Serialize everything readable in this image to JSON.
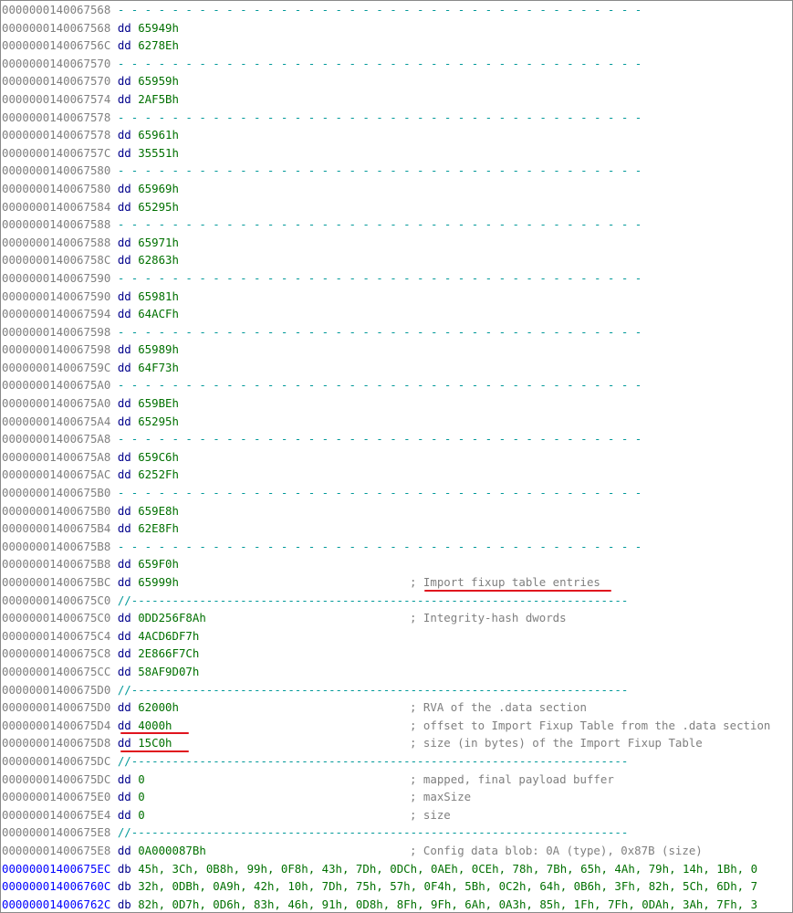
{
  "colors": {
    "address": "#7f7f7f",
    "address_blue": "#0000ff",
    "mnemonic": "#00008b",
    "operand": "#007000",
    "separator": "#009999",
    "comment": "#7f7f7f",
    "highlight_red": "#e0141e"
  },
  "lines": [
    {
      "addr": "0000000140067568",
      "sep": " - - - - - - - - - - - - - - - - - - - - - - - - - - - - - - - - - - - - - - -"
    },
    {
      "addr": "0000000140067568",
      "mn": "dd",
      "op": "65949h"
    },
    {
      "addr": "000000014006756C",
      "mn": "dd",
      "op": "6278Eh"
    },
    {
      "addr": "0000000140067570",
      "sep": " - - - - - - - - - - - - - - - - - - - - - - - - - - - - - - - - - - - - - - -"
    },
    {
      "addr": "0000000140067570",
      "mn": "dd",
      "op": "65959h"
    },
    {
      "addr": "0000000140067574",
      "mn": "dd",
      "op": "2AF5Bh"
    },
    {
      "addr": "0000000140067578",
      "sep": " - - - - - - - - - - - - - - - - - - - - - - - - - - - - - - - - - - - - - - -"
    },
    {
      "addr": "0000000140067578",
      "mn": "dd",
      "op": "65961h"
    },
    {
      "addr": "000000014006757C",
      "mn": "dd",
      "op": "35551h"
    },
    {
      "addr": "0000000140067580",
      "sep": " - - - - - - - - - - - - - - - - - - - - - - - - - - - - - - - - - - - - - - -"
    },
    {
      "addr": "0000000140067580",
      "mn": "dd",
      "op": "65969h"
    },
    {
      "addr": "0000000140067584",
      "mn": "dd",
      "op": "65295h"
    },
    {
      "addr": "0000000140067588",
      "sep": " - - - - - - - - - - - - - - - - - - - - - - - - - - - - - - - - - - - - - - -"
    },
    {
      "addr": "0000000140067588",
      "mn": "dd",
      "op": "65971h"
    },
    {
      "addr": "000000014006758C",
      "mn": "dd",
      "op": "62863h"
    },
    {
      "addr": "0000000140067590",
      "sep": " - - - - - - - - - - - - - - - - - - - - - - - - - - - - - - - - - - - - - - -"
    },
    {
      "addr": "0000000140067590",
      "mn": "dd",
      "op": "65981h"
    },
    {
      "addr": "0000000140067594",
      "mn": "dd",
      "op": "64ACFh"
    },
    {
      "addr": "0000000140067598",
      "sep": " - - - - - - - - - - - - - - - - - - - - - - - - - - - - - - - - - - - - - - -"
    },
    {
      "addr": "0000000140067598",
      "mn": "dd",
      "op": "65989h"
    },
    {
      "addr": "000000014006759C",
      "mn": "dd",
      "op": "64F73h"
    },
    {
      "addr": "00000001400675A0",
      "sep": " - - - - - - - - - - - - - - - - - - - - - - - - - - - - - - - - - - - - - - -"
    },
    {
      "addr": "00000001400675A0",
      "mn": "dd",
      "op": "659BEh"
    },
    {
      "addr": "00000001400675A4",
      "mn": "dd",
      "op": "65295h"
    },
    {
      "addr": "00000001400675A8",
      "sep": " - - - - - - - - - - - - - - - - - - - - - - - - - - - - - - - - - - - - - - -"
    },
    {
      "addr": "00000001400675A8",
      "mn": "dd",
      "op": "659C6h"
    },
    {
      "addr": "00000001400675AC",
      "mn": "dd",
      "op": "6252Fh"
    },
    {
      "addr": "00000001400675B0",
      "sep": " - - - - - - - - - - - - - - - - - - - - - - - - - - - - - - - - - - - - - - -"
    },
    {
      "addr": "00000001400675B0",
      "mn": "dd",
      "op": "659E8h"
    },
    {
      "addr": "00000001400675B4",
      "mn": "dd",
      "op": "62E8Fh"
    },
    {
      "addr": "00000001400675B8",
      "sep": " - - - - - - - - - - - - - - - - - - - - - - - - - - - - - - - - - - - - - - -"
    },
    {
      "addr": "00000001400675B8",
      "mn": "dd",
      "op": "659F0h"
    },
    {
      "addr": "00000001400675BC",
      "mn": "dd",
      "op": "65999h",
      "cmt": "; Import fixup table entries"
    },
    {
      "addr": "00000001400675C0",
      "sep": " //-------------------------------------------------------------------------"
    },
    {
      "addr": "00000001400675C0",
      "mn": "dd",
      "op": "0DD256F8Ah",
      "cmt": "; Integrity-hash dwords"
    },
    {
      "addr": "00000001400675C4",
      "mn": "dd",
      "op": "4ACD6DF7h"
    },
    {
      "addr": "00000001400675C8",
      "mn": "dd",
      "op": "2E866F7Ch"
    },
    {
      "addr": "00000001400675CC",
      "mn": "dd",
      "op": "58AF9D07h"
    },
    {
      "addr": "00000001400675D0",
      "sep": " //-------------------------------------------------------------------------"
    },
    {
      "addr": "00000001400675D0",
      "mn": "dd",
      "op": "62000h",
      "cmt": "; RVA of the .data section"
    },
    {
      "addr": "00000001400675D4",
      "mn": "dd",
      "op": "4000h",
      "cmt": "; offset to Import Fixup Table from the .data section"
    },
    {
      "addr": "00000001400675D8",
      "mn": "dd",
      "op": "15C0h",
      "cmt": "; size (in bytes) of the Import Fixup Table"
    },
    {
      "addr": "00000001400675DC",
      "sep": " //-------------------------------------------------------------------------"
    },
    {
      "addr": "00000001400675DC",
      "mn": "dd",
      "op": "0",
      "cmt": "; mapped, final payload buffer"
    },
    {
      "addr": "00000001400675E0",
      "mn": "dd",
      "op": "0",
      "cmt": "; maxSize"
    },
    {
      "addr": "00000001400675E4",
      "mn": "dd",
      "op": "0",
      "cmt": "; size"
    },
    {
      "addr": "00000001400675E8",
      "sep": " //-------------------------------------------------------------------------"
    },
    {
      "addr": "00000001400675E8",
      "mn": "dd",
      "op": "0A000087Bh",
      "cmt": "; Config data blob: 0A (type), 0x87B (size)"
    },
    {
      "addr": "00000001400675EC",
      "blue": true,
      "mn": "db",
      "op": "45h, 3Ch, 0B8h, 99h, 0F8h, 43h, 7Dh, 0DCh, 0AEh, 0CEh, 78h, 7Bh, 65h, 4Ah, 79h, 14h, 1Bh, 0"
    },
    {
      "addr": "000000014006760C",
      "blue": true,
      "mn": "db",
      "op": "32h, 0DBh, 0A9h, 42h, 10h, 7Dh, 75h, 57h, 0F4h, 5Bh, 0C2h, 64h, 0B6h, 3Fh, 82h, 5Ch, 6Dh, 7"
    },
    {
      "addr": "000000014006762C",
      "blue": true,
      "mn": "db",
      "op": "82h, 0D7h, 0D6h, 83h, 46h, 91h, 0D8h, 8Fh, 9Fh, 6Ah, 0A3h, 85h, 1Fh, 7Fh, 0DAh, 3Ah, 7Fh, 3"
    }
  ]
}
